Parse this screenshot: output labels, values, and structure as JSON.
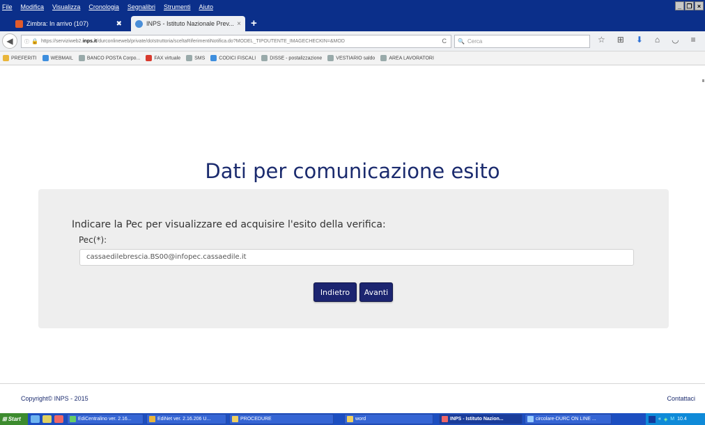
{
  "menubar": {
    "items": [
      "File",
      "Modifica",
      "Visualizza",
      "Cronologia",
      "Segnalibri",
      "Strumenti",
      "Aiuto"
    ]
  },
  "tabs": [
    {
      "label": "Zimbra: In arrivo (107)",
      "active": false
    },
    {
      "label": "INPS - Istituto Nazionale Prev...",
      "active": true
    }
  ],
  "navbar": {
    "url_prefix": "https://serviziweb2.",
    "url_domain": "inps.it",
    "url_rest": "/durconlineweb/private/doIstruttoria/sceltaRiferimentiNotifica.do?MODEL_TIPOUTENTE_IMAGECHECKIN=&MOD",
    "search_placeholder": "Cerca"
  },
  "bookmarks": [
    "PREFERITI",
    "WEBMAIL",
    "BANCO POSTA Corpo...",
    "FAX virtuale",
    "SMS",
    "CODICI FISCALI",
    "DISSE - postalizzazione",
    "VESTIARIO saldo",
    "AREA LAVORATORI"
  ],
  "page": {
    "title": "Dati per comunicazione esito",
    "instruction": "Indicare la Pec per visualizzare ed acquisire l'esito della verifica:",
    "pec_label": "Pec(*):",
    "pec_value": "cassaedilebrescia.BS00@infopec.cassaedile.it",
    "back_label": "Indietro",
    "next_label": "Avanti",
    "copyright": "Copyright© INPS - 2015",
    "contact": "Contattaci"
  },
  "taskbar": {
    "start": "Start",
    "items": [
      "EdiCentralino ver. 2.16...",
      "EdiNet ver. 2.16.206 U...",
      "PROCEDURE",
      "word",
      "INPS - Istituto Nazion...",
      "circolare-DURC ON LINE ..."
    ],
    "clock": "10.4"
  },
  "colors": {
    "title_blue": "#1b2b6e",
    "button_navy": "#1c2570",
    "form_bg": "#eeeeee",
    "taskbar_blue": "#1c4ec0"
  }
}
